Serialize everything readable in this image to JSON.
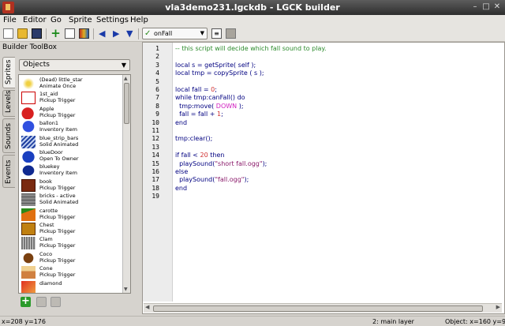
{
  "window": {
    "title": "vla3demo231.lgckdb - LGCK builder"
  },
  "menu": [
    "File",
    "Editor",
    "Go",
    "Sprite",
    "Settings",
    "Help"
  ],
  "toolbar": {
    "action_combo": "onFall",
    "icons": [
      "new-file-icon",
      "open-folder-icon",
      "save-icon",
      "add-icon",
      "edit-icon",
      "image-icon",
      "arrow-left-icon",
      "arrow-right-icon",
      "arrow-down-icon",
      "text-icon",
      "settings-icon"
    ]
  },
  "toolbox": {
    "title": "Builder ToolBox",
    "tabs": [
      "Sprites",
      "Levels",
      "Sounds",
      "Events"
    ],
    "filter": "Objects",
    "items": [
      {
        "name": "(Dead) little_star",
        "type": "Animate Once"
      },
      {
        "name": "1st_aid",
        "type": "Pickup Trigger"
      },
      {
        "name": "Apple",
        "type": "Pickup Trigger"
      },
      {
        "name": "ballon1",
        "type": "Inventory Item"
      },
      {
        "name": "blue_strip_bars",
        "type": "Solid Animated"
      },
      {
        "name": "blueDoor",
        "type": "Open To Owner"
      },
      {
        "name": "bluekey",
        "type": "Inventory Item"
      },
      {
        "name": "book",
        "type": "Pickup Trigger"
      },
      {
        "name": "bricks - active",
        "type": "Solid Animated"
      },
      {
        "name": "carotte",
        "type": "Pickup Trigger"
      },
      {
        "name": "Chest",
        "type": "Pickup Trigger"
      },
      {
        "name": "Clam",
        "type": "Pickup Trigger"
      },
      {
        "name": "Coco",
        "type": "Pickup Trigger"
      },
      {
        "name": "Cone",
        "type": "Pickup Trigger"
      },
      {
        "name": "diamond",
        "type": ""
      }
    ]
  },
  "editor": {
    "line_numbers": [
      "1",
      "2",
      "3",
      "4",
      "5",
      "6",
      "7",
      "8",
      "9",
      "10",
      "11",
      "12",
      "13",
      "14",
      "15",
      "16",
      "17",
      "18",
      "19"
    ],
    "lines": [
      [
        [
          "cmt",
          "-- this script will decide which fall sound to play."
        ]
      ],
      [],
      [
        [
          "plain",
          "local s = getSprite( self );"
        ]
      ],
      [
        [
          "plain",
          "local tmp = copySprite ( s );"
        ]
      ],
      [],
      [
        [
          "plain",
          "local fall = "
        ],
        [
          "num",
          "0"
        ],
        [
          "plain",
          ";"
        ]
      ],
      [
        [
          "plain",
          "while tmp:canFall() do"
        ]
      ],
      [
        [
          "plain",
          "  tmp:move( "
        ],
        [
          "const",
          "DOWN"
        ],
        [
          "plain",
          " );"
        ]
      ],
      [
        [
          "plain",
          "  fall = fall + "
        ],
        [
          "num",
          "1"
        ],
        [
          "plain",
          ";"
        ]
      ],
      [
        [
          "plain",
          "end"
        ]
      ],
      [],
      [
        [
          "plain",
          "tmp:clear();"
        ]
      ],
      [],
      [
        [
          "plain",
          "if fall < "
        ],
        [
          "num",
          "20"
        ],
        [
          "plain",
          " then"
        ]
      ],
      [
        [
          "plain",
          "  playSound("
        ],
        [
          "str",
          "\"short fall.ogg\""
        ],
        [
          "plain",
          ");"
        ]
      ],
      [
        [
          "plain",
          "else"
        ]
      ],
      [
        [
          "plain",
          "  playSound("
        ],
        [
          "str",
          "\"fall.ogg\""
        ],
        [
          "plain",
          ");"
        ]
      ],
      [
        [
          "plain",
          "end"
        ]
      ],
      []
    ]
  },
  "status": {
    "mouse": "x=208 y=176",
    "layer": "2: main layer",
    "object": "Object: x=160 y=96"
  }
}
